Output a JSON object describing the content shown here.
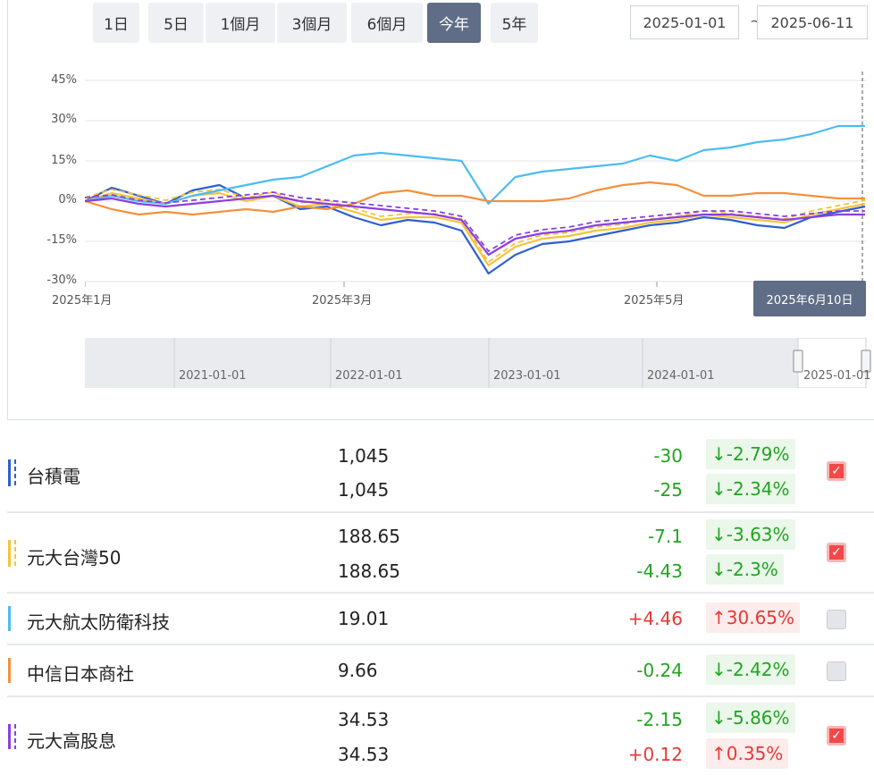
{
  "toolbar": {
    "ranges": [
      "1日",
      "5日",
      "1個月",
      "3個月",
      "6個月",
      "今年",
      "5年"
    ],
    "active_range": "今年",
    "start_date": "2025-01-01",
    "end_date": "2025-06-11",
    "separator": "~"
  },
  "chart_data": {
    "type": "line",
    "y_ticks": [
      "45%",
      "30%",
      "15%",
      "0%",
      "-15%",
      "-30%"
    ],
    "ylim": [
      -30,
      45
    ],
    "x_ticks": [
      "2025年1月",
      "2025年3月",
      "2025年5月"
    ],
    "tooltip_date": "2025年6月10日",
    "navigator_labels": [
      "2021-01-01",
      "2022-01-01",
      "2023-01-01",
      "2024-01-01",
      "2025-01-01"
    ],
    "series": [
      {
        "name": "台積電",
        "color": "#2f5fd0",
        "values": [
          0,
          5,
          2,
          -1,
          4,
          6,
          1,
          2,
          -3,
          -2,
          -6,
          -9,
          -7,
          -8,
          -11,
          -27,
          -20,
          -16,
          -15,
          -13,
          -11,
          -9,
          -8,
          -6,
          -7,
          -9,
          -10,
          -6,
          -4,
          -2
        ]
      },
      {
        "name": "元大台灣50",
        "color": "#f5c33b",
        "values": [
          0,
          3,
          1,
          -1,
          2,
          3,
          0,
          2,
          -2,
          -1,
          -4,
          -7,
          -6,
          -6,
          -8,
          -24,
          -17,
          -14,
          -13,
          -11,
          -10,
          -8,
          -7,
          -5,
          -6,
          -7,
          -8,
          -5,
          -3,
          -1
        ]
      },
      {
        "name": "元大航太防衛科技",
        "color": "#4cbcf0",
        "values": [
          0,
          2,
          0,
          -1,
          2,
          4,
          6,
          8,
          9,
          13,
          17,
          18,
          17,
          16,
          15,
          -1,
          9,
          11,
          12,
          13,
          14,
          17,
          15,
          19,
          20,
          22,
          23,
          25,
          28,
          28
        ]
      },
      {
        "name": "中信日本商社",
        "color": "#f2913d",
        "values": [
          0,
          -3,
          -5,
          -4,
          -5,
          -4,
          -3,
          -4,
          -2,
          -3,
          -1,
          3,
          4,
          2,
          2,
          0,
          0,
          0,
          1,
          4,
          6,
          7,
          6,
          2,
          2,
          3,
          3,
          2,
          1,
          1
        ]
      },
      {
        "name": "元大高股息",
        "color": "#8b3fe0",
        "values": [
          0,
          1,
          -1,
          -2,
          -1,
          0,
          1,
          2,
          0,
          -1,
          -2,
          -3,
          -4,
          -5,
          -7,
          -20,
          -14,
          -12,
          -11,
          -9,
          -8,
          -7,
          -6,
          -5,
          -5,
          -6,
          -7,
          -6,
          -5,
          -5
        ]
      }
    ]
  },
  "stocks": [
    {
      "name": "台積電",
      "color": "#2f5fd0",
      "checked": true,
      "lines": [
        {
          "price": "1,045",
          "change": "-30",
          "pct": "-2.79%",
          "dir": "down"
        },
        {
          "price": "1,045",
          "change": "-25",
          "pct": "-2.34%",
          "dir": "down"
        }
      ]
    },
    {
      "name": "元大台灣50",
      "color": "#f5c33b",
      "checked": true,
      "lines": [
        {
          "price": "188.65",
          "change": "-7.1",
          "pct": "-3.63%",
          "dir": "down"
        },
        {
          "price": "188.65",
          "change": "-4.43",
          "pct": "-2.3%",
          "dir": "down"
        }
      ]
    },
    {
      "name": "元大航太防衛科技",
      "color": "#4cbcf0",
      "checked": false,
      "lines": [
        {
          "price": "19.01",
          "change": "+4.46",
          "pct": "30.65%",
          "dir": "up"
        }
      ]
    },
    {
      "name": "中信日本商社",
      "color": "#f2913d",
      "checked": false,
      "lines": [
        {
          "price": "9.66",
          "change": "-0.24",
          "pct": "-2.42%",
          "dir": "down"
        }
      ]
    },
    {
      "name": "元大高股息",
      "color": "#8b3fe0",
      "checked": true,
      "lines": [
        {
          "price": "34.53",
          "change": "-2.15",
          "pct": "-5.86%",
          "dir": "down"
        },
        {
          "price": "34.53",
          "change": "+0.12",
          "pct": "0.35%",
          "dir": "up"
        }
      ]
    }
  ]
}
